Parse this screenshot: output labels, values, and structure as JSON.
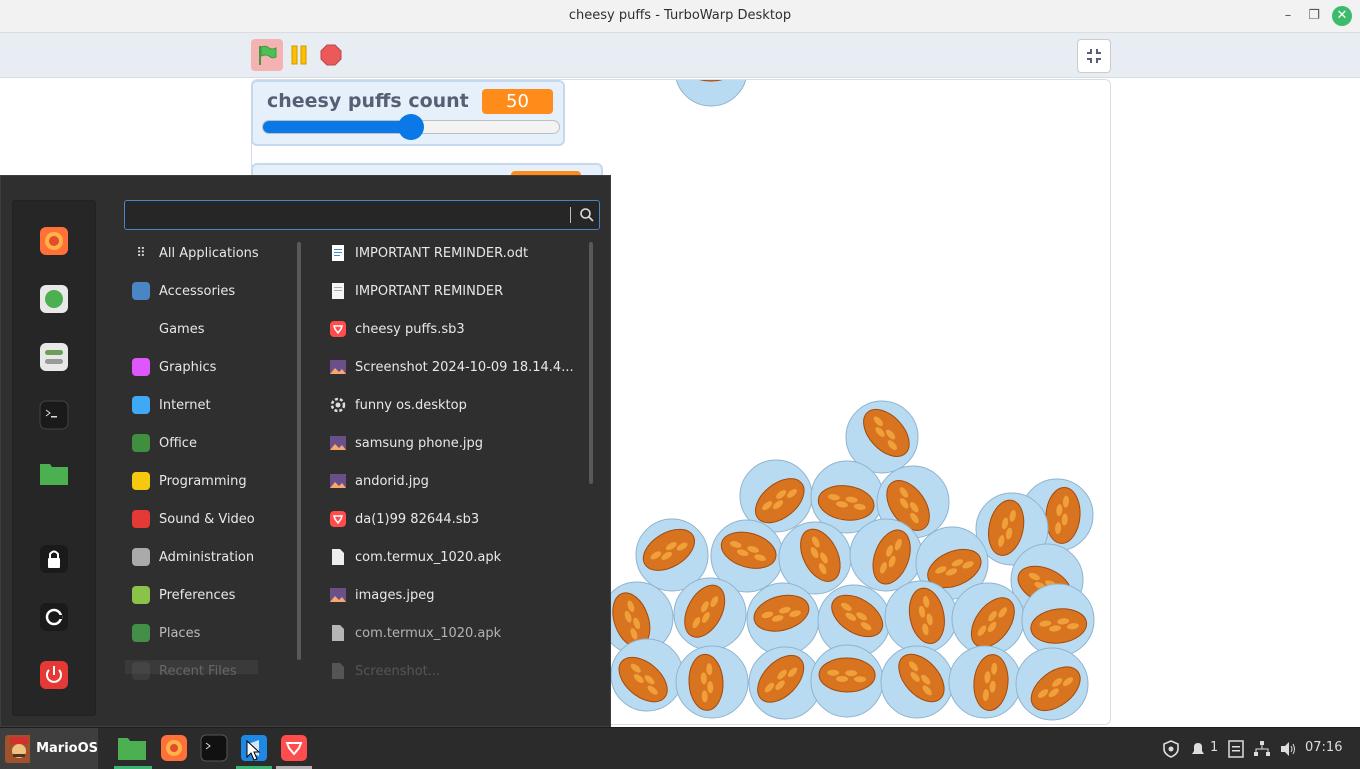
{
  "window": {
    "title": "cheesy puffs - TurboWarp Desktop",
    "minimize_glyph": "–",
    "maximize_glyph": "❐",
    "close_glyph": "✕"
  },
  "toolbar": {
    "icons": [
      "green-flag-icon",
      "pause-icon",
      "stop-icon",
      "fullscreen-exit-icon"
    ]
  },
  "monitor": {
    "label": "cheesy puffs count",
    "value": "50",
    "slider_level": 0.5
  },
  "menu": {
    "search": {
      "value": "",
      "placeholder": ""
    },
    "favorites": [
      "firefox",
      "system-monitor",
      "settings",
      "terminal",
      "files",
      "lock-screen",
      "logout",
      "power"
    ],
    "categories": [
      {
        "label": "All Applications",
        "icon": "grid-icon"
      },
      {
        "label": "Accessories",
        "icon": "scissors-icon"
      },
      {
        "label": "Games",
        "icon": "gamepad-icon"
      },
      {
        "label": "Graphics",
        "icon": "palette-icon"
      },
      {
        "label": "Internet",
        "icon": "cloud-icon"
      },
      {
        "label": "Office",
        "icon": "spreadsheet-icon"
      },
      {
        "label": "Programming",
        "icon": "code-icon"
      },
      {
        "label": "Sound & Video",
        "icon": "play-icon"
      },
      {
        "label": "Administration",
        "icon": "admin-icon"
      },
      {
        "label": "Preferences",
        "icon": "preferences-icon"
      },
      {
        "label": "Places",
        "icon": "folder-icon"
      },
      {
        "label": "Recent Files",
        "icon": "recent-icon"
      }
    ],
    "files": [
      {
        "label": "IMPORTANT REMINDER.odt",
        "icon": "document-icon"
      },
      {
        "label": "IMPORTANT REMINDER",
        "icon": "text-file-icon"
      },
      {
        "label": "cheesy puffs.sb3",
        "icon": "turbowarp-icon"
      },
      {
        "label": "Screenshot 2024-10-09 18.14.4...",
        "icon": "image-icon"
      },
      {
        "label": "funny os.desktop",
        "icon": "gear-icon"
      },
      {
        "label": "samsung  phone.jpg",
        "icon": "image-icon"
      },
      {
        "label": "andorid.jpg",
        "icon": "image-icon"
      },
      {
        "label": "da(1)99 82644.sb3",
        "icon": "turbowarp-icon"
      },
      {
        "label": "com.termux_1020.apk",
        "icon": "file-icon"
      },
      {
        "label": "images.jpeg",
        "icon": "image-icon"
      },
      {
        "label": "com.termux_1020.apk",
        "icon": "file-icon"
      },
      {
        "label": "Screenshot...",
        "icon": "file-icon"
      }
    ]
  },
  "taskbar": {
    "menu_label": "MarioOS",
    "apps": [
      "files",
      "firefox",
      "terminal",
      "vscode",
      "turbowarp"
    ],
    "notifications": "1",
    "clock": "07:16"
  },
  "colors": {
    "accent": "#4a86c5",
    "monitor_value": "#ff8c1a",
    "slider": "#0a78e6",
    "close": "#3dbb6d"
  }
}
